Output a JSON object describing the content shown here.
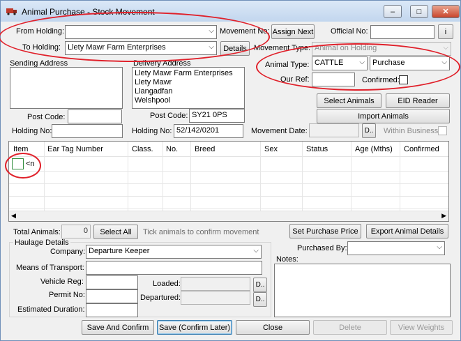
{
  "window": {
    "title": "Animal Purchase - Stock Movement",
    "min_label": "–",
    "max_label": "□",
    "close_label": "✕"
  },
  "colors": {
    "annotation": "#e0202a",
    "title_bar": "#c8d9ef",
    "close_button": "#c9452c"
  },
  "form": {
    "from_holding_label": "From Holding:",
    "from_holding_value": "",
    "to_holding_label": "To Holding:",
    "to_holding_value": "Llety Mawr Farm Enterprises",
    "details_label": "Details",
    "movement_no_label": "Movement No:",
    "assign_next_label": "Assign Next",
    "official_no_label": "Official No:",
    "official_no_value": "",
    "info_label": "i",
    "movement_type_label": "Movement Type:",
    "movement_type_value": "Animal on Holding",
    "animal_type_label": "Animal Type:",
    "animal_type_value": "CATTLE",
    "purchase_type_value": "Purchase",
    "our_ref_label": "Our Ref:",
    "our_ref_value": "",
    "confirmed_label": "Confirmed:",
    "sending_address_label": "Sending Address",
    "sending_address_value": "",
    "delivery_address_label": "Delivery Address",
    "delivery_address_lines": [
      "Llety Mawr Farm Enterprises",
      "Llety Mawr",
      "Llangadfan",
      "Welshpool"
    ],
    "post_code_label": "Post Code:",
    "sending_post_code_value": "",
    "delivery_post_code_value": "SY21 0PS",
    "holding_no_label": "Holding No:",
    "sending_holding_no_value": "",
    "delivery_holding_no_value": "52/142/0201",
    "movement_date_label": "Movement Date:",
    "movement_date_value": "",
    "date_picker_label": "D..",
    "within_business_label": "Within Business",
    "select_animals_label": "Select Animals",
    "eid_reader_label": "EID Reader",
    "import_animals_label": "Import Animals"
  },
  "grid": {
    "columns": [
      "Item",
      "Ear Tag Number",
      "Class.",
      "No.",
      "Breed",
      "Sex",
      "Status",
      "Age (Mths)",
      "Confirmed"
    ],
    "new_row_marker": "<n"
  },
  "summary": {
    "total_animals_label": "Total Animals:",
    "total_animals_value": "0",
    "select_all_label": "Select All",
    "hint": "Tick animals to confirm movement",
    "set_purchase_price_label": "Set Purchase Price",
    "export_animal_details_label": "Export Animal Details"
  },
  "haulage": {
    "group_label": "Haulage Details",
    "company_label": "Company:",
    "company_value": "Departure Keeper",
    "means_label": "Means of Transport:",
    "means_value": "",
    "vehicle_reg_label": "Vehicle Reg:",
    "vehicle_reg_value": "",
    "permit_no_label": "Permit No:",
    "permit_no_value": "",
    "estimated_duration_label": "Estimated Duration:",
    "estimated_duration_value": "",
    "loaded_label": "Loaded:",
    "departured_label": "Departured:",
    "date_picker_label": "D.."
  },
  "purchase": {
    "purchased_by_label": "Purchased By:",
    "purchased_by_value": "",
    "notes_label": "Notes:",
    "notes_value": ""
  },
  "footer": {
    "save_confirm_label": "Save And Confirm",
    "save_confirm_later_label": "Save (Confirm Later)",
    "close_label": "Close",
    "delete_label": "Delete",
    "view_weights_label": "View Weights"
  }
}
